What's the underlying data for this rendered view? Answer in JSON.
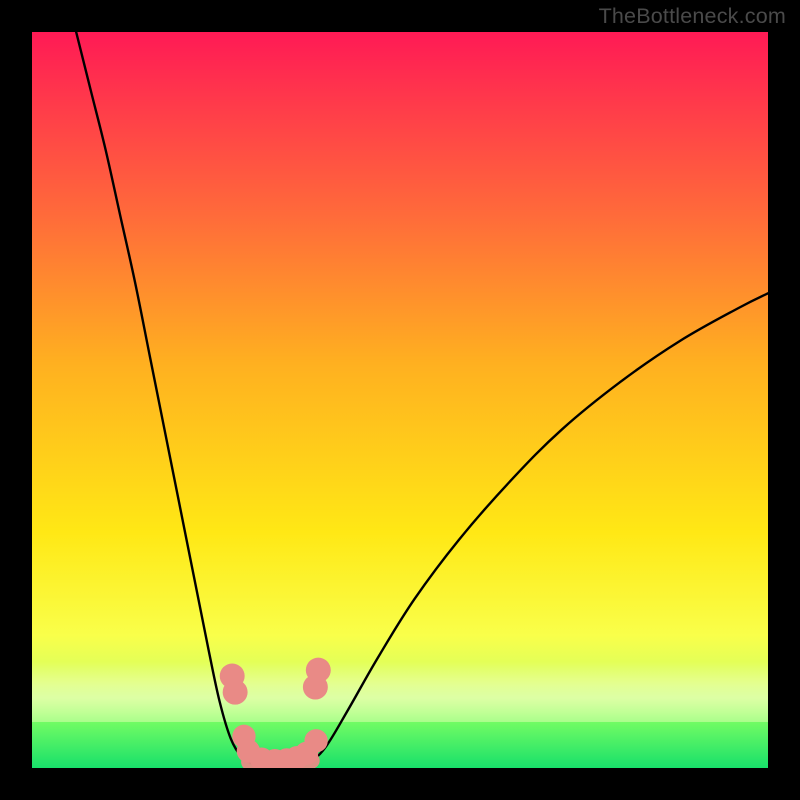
{
  "watermark": "TheBottleneck.com",
  "chart_data": {
    "type": "line",
    "title": "",
    "xlabel": "",
    "ylabel": "",
    "xlim": [
      0,
      100
    ],
    "ylim": [
      0,
      100
    ],
    "series": [
      {
        "name": "left-branch",
        "x": [
          6,
          8,
          10,
          12,
          14,
          16,
          18,
          20,
          22,
          24,
          25.5,
          27,
          28.5,
          29.5
        ],
        "y": [
          100,
          92,
          84,
          75,
          66,
          56,
          46,
          36,
          26,
          16,
          9,
          4,
          1.5,
          0.8
        ]
      },
      {
        "name": "valley",
        "x": [
          29.5,
          30.5,
          32,
          33.5,
          35,
          36.5,
          38
        ],
        "y": [
          0.8,
          0.4,
          0.3,
          0.3,
          0.4,
          0.6,
          1.0
        ]
      },
      {
        "name": "right-branch",
        "x": [
          38,
          40,
          43,
          47,
          52,
          58,
          65,
          72,
          80,
          88,
          96,
          100
        ],
        "y": [
          1.0,
          3,
          8,
          15,
          23,
          31,
          39,
          46,
          52.5,
          58,
          62.5,
          64.5
        ]
      }
    ],
    "markers": {
      "name": "highlight-dots",
      "color": "#e98a86",
      "points": [
        {
          "x": 27.2,
          "y": 12.5,
          "r": 1.6
        },
        {
          "x": 27.6,
          "y": 10.3,
          "r": 1.6
        },
        {
          "x": 28.8,
          "y": 4.3,
          "r": 1.4
        },
        {
          "x": 29.4,
          "y": 2.3,
          "r": 1.4
        },
        {
          "x": 31.2,
          "y": 1.2,
          "r": 1.4
        },
        {
          "x": 33.0,
          "y": 1.0,
          "r": 1.4
        },
        {
          "x": 34.6,
          "y": 1.1,
          "r": 1.4
        },
        {
          "x": 36.0,
          "y": 1.4,
          "r": 1.4
        },
        {
          "x": 37.3,
          "y": 2.0,
          "r": 1.4
        },
        {
          "x": 38.6,
          "y": 3.7,
          "r": 1.4
        },
        {
          "x": 38.5,
          "y": 11.0,
          "r": 1.6
        },
        {
          "x": 38.9,
          "y": 13.3,
          "r": 1.6
        }
      ]
    },
    "gradient_stops": [
      {
        "pos": 0,
        "color": "#ff1a55"
      },
      {
        "pos": 10,
        "color": "#ff3b4a"
      },
      {
        "pos": 25,
        "color": "#ff6b3a"
      },
      {
        "pos": 45,
        "color": "#ffb020"
      },
      {
        "pos": 68,
        "color": "#ffe815"
      },
      {
        "pos": 82,
        "color": "#f9ff4a"
      },
      {
        "pos": 88,
        "color": "#d6ff60"
      },
      {
        "pos": 93,
        "color": "#7cff63"
      },
      {
        "pos": 100,
        "color": "#18e06a"
      }
    ]
  }
}
